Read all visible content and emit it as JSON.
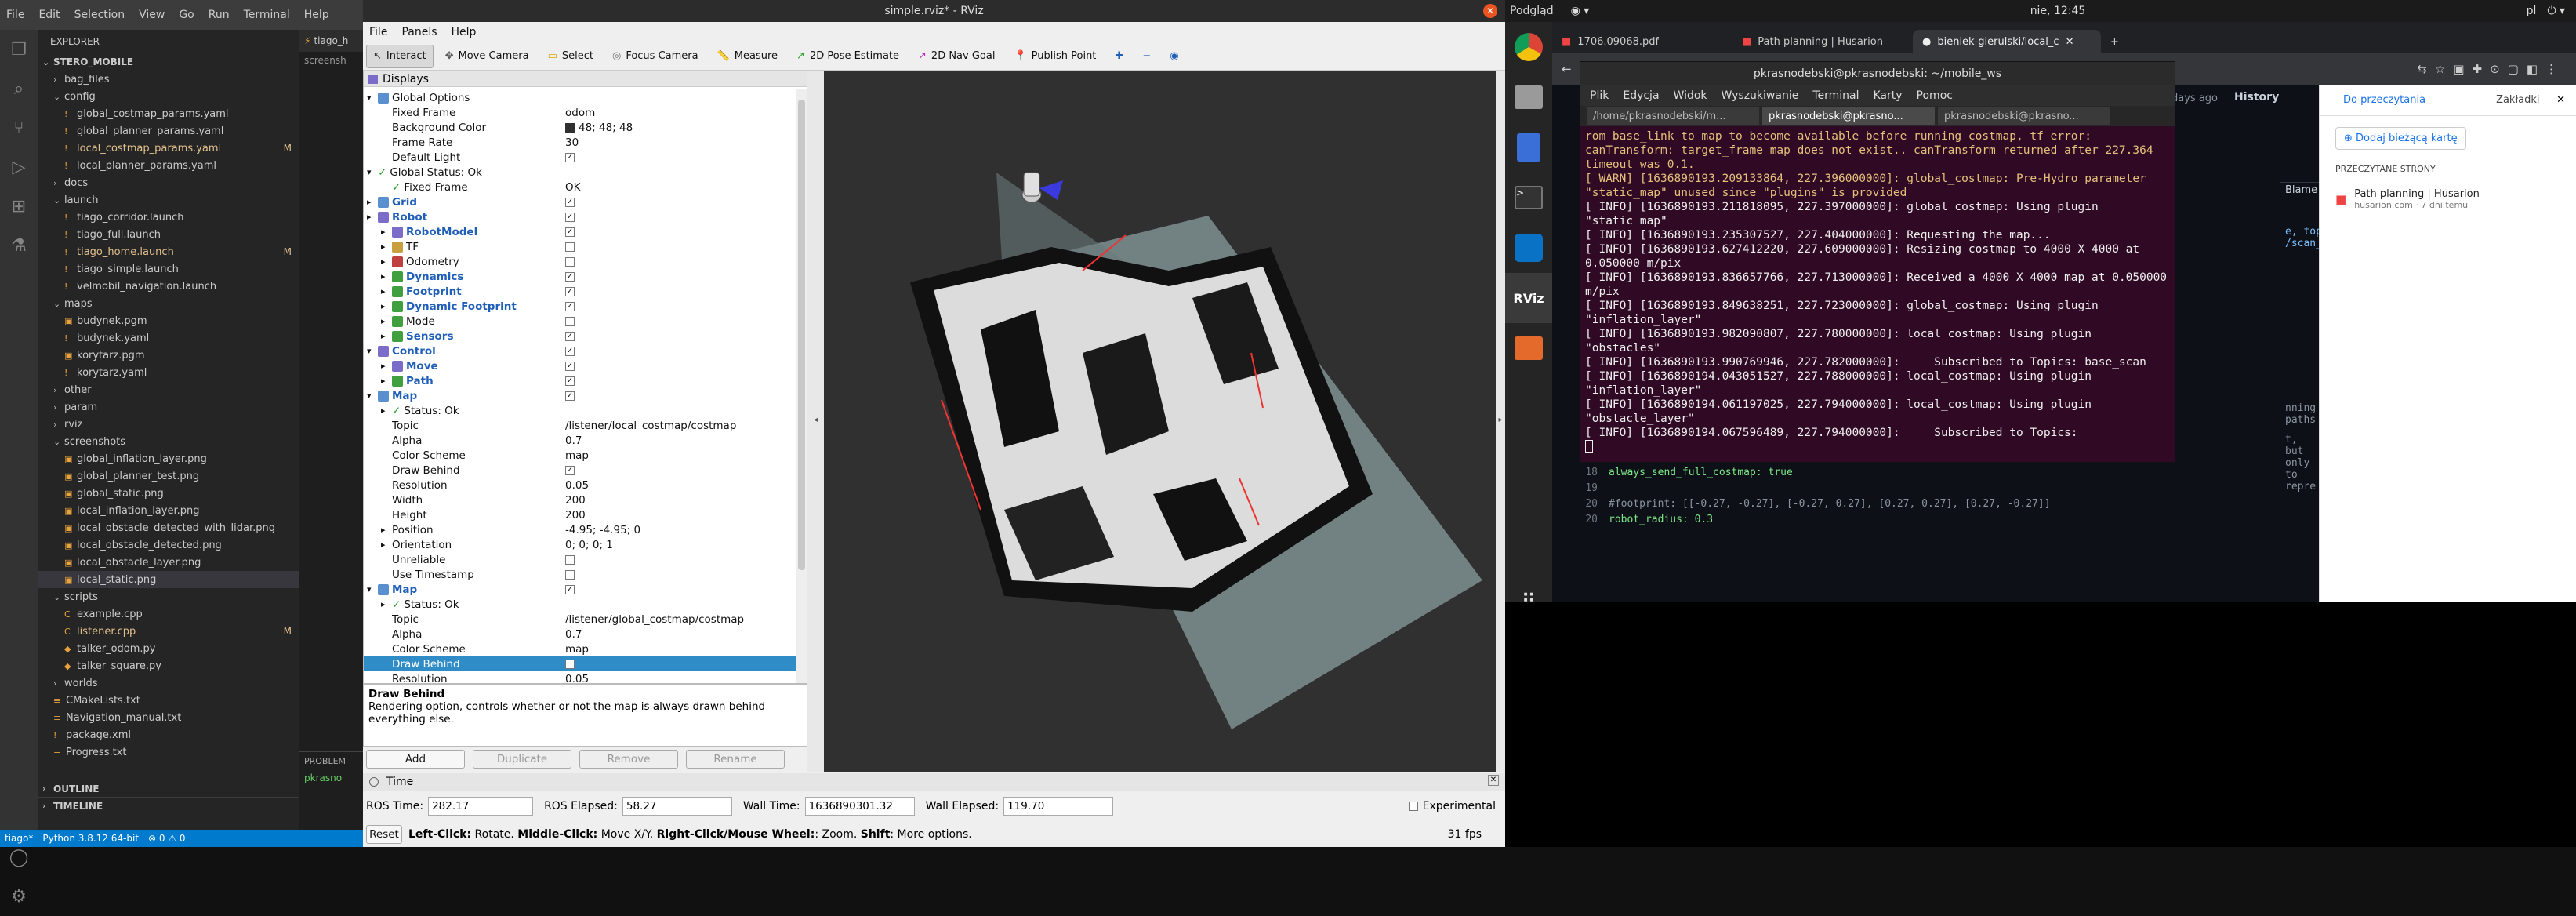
{
  "vscode": {
    "menu": [
      "File",
      "Edit",
      "Selection",
      "View",
      "Go",
      "Run",
      "Terminal",
      "Help"
    ],
    "explorer_title": "EXPLORER",
    "tree": [
      {
        "t": "STERO_MOBILE",
        "d": 0,
        "type": "root"
      },
      {
        "t": "bag_files",
        "d": 1,
        "type": "folder",
        "open": false
      },
      {
        "t": "config",
        "d": 1,
        "type": "folder",
        "open": true
      },
      {
        "t": "global_costmap_params.yaml",
        "d": 2,
        "type": "file"
      },
      {
        "t": "global_planner_params.yaml",
        "d": 2,
        "type": "file"
      },
      {
        "t": "local_costmap_params.yaml",
        "d": 2,
        "type": "file",
        "mod": "M"
      },
      {
        "t": "local_planner_params.yaml",
        "d": 2,
        "type": "file"
      },
      {
        "t": "docs",
        "d": 1,
        "type": "folder",
        "open": false
      },
      {
        "t": "launch",
        "d": 1,
        "type": "folder",
        "open": true
      },
      {
        "t": "tiago_corridor.launch",
        "d": 2,
        "type": "file"
      },
      {
        "t": "tiago_full.launch",
        "d": 2,
        "type": "file"
      },
      {
        "t": "tiago_home.launch",
        "d": 2,
        "type": "file",
        "mod": "M"
      },
      {
        "t": "tiago_simple.launch",
        "d": 2,
        "type": "file"
      },
      {
        "t": "velmobil_navigation.launch",
        "d": 2,
        "type": "file"
      },
      {
        "t": "maps",
        "d": 1,
        "type": "folder",
        "open": true
      },
      {
        "t": "budynek.pgm",
        "d": 2,
        "type": "file"
      },
      {
        "t": "budynek.yaml",
        "d": 2,
        "type": "file"
      },
      {
        "t": "korytarz.pgm",
        "d": 2,
        "type": "file"
      },
      {
        "t": "korytarz.yaml",
        "d": 2,
        "type": "file"
      },
      {
        "t": "other",
        "d": 1,
        "type": "folder",
        "open": false
      },
      {
        "t": "param",
        "d": 1,
        "type": "folder",
        "open": false
      },
      {
        "t": "rviz",
        "d": 1,
        "type": "folder",
        "open": false
      },
      {
        "t": "screenshots",
        "d": 1,
        "type": "folder",
        "open": true
      },
      {
        "t": "global_inflation_layer.png",
        "d": 2,
        "type": "file"
      },
      {
        "t": "global_planner_test.png",
        "d": 2,
        "type": "file"
      },
      {
        "t": "global_static.png",
        "d": 2,
        "type": "file"
      },
      {
        "t": "local_inflation_layer.png",
        "d": 2,
        "type": "file"
      },
      {
        "t": "local_obstacle_detected_with_lidar.png",
        "d": 2,
        "type": "file"
      },
      {
        "t": "local_obstacle_detected.png",
        "d": 2,
        "type": "file"
      },
      {
        "t": "local_obstacle_layer.png",
        "d": 2,
        "type": "file"
      },
      {
        "t": "local_static.png",
        "d": 2,
        "type": "file",
        "sel": true
      },
      {
        "t": "scripts",
        "d": 1,
        "type": "folder",
        "open": true
      },
      {
        "t": "example.cpp",
        "d": 2,
        "type": "file"
      },
      {
        "t": "listener.cpp",
        "d": 2,
        "type": "file",
        "mod": "M"
      },
      {
        "t": "talker_odom.py",
        "d": 2,
        "type": "file"
      },
      {
        "t": "talker_square.py",
        "d": 2,
        "type": "file"
      },
      {
        "t": "worlds",
        "d": 1,
        "type": "folder",
        "open": false
      },
      {
        "t": "CMakeLists.txt",
        "d": 1,
        "type": "file"
      },
      {
        "t": "Navigation_manual.txt",
        "d": 1,
        "type": "file"
      },
      {
        "t": "package.xml",
        "d": 1,
        "type": "file"
      },
      {
        "t": "Progress.txt",
        "d": 1,
        "type": "file"
      }
    ],
    "outline": "OUTLINE",
    "timeline": "TIMELINE",
    "editor_tab": "tiago_h",
    "editor_crumb": "screensh",
    "problems": "PROBLEM",
    "terminal_snip": "pkrasno",
    "status": {
      "branch": "tiago*",
      "python": "Python 3.8.12 64-bit",
      "errors": "⊗ 0 ⚠ 0"
    }
  },
  "topbar": {
    "left": "Podgląd",
    "clock": "nie, 12:45",
    "lang": "pl"
  },
  "rviz": {
    "title": "simple.rviz* - RViz",
    "menu": [
      "File",
      "Panels",
      "Help"
    ],
    "tools": [
      {
        "label": "Interact",
        "active": true
      },
      {
        "label": "Move Camera"
      },
      {
        "label": "Select"
      },
      {
        "label": "Focus Camera"
      },
      {
        "label": "Measure"
      },
      {
        "label": "2D Pose Estimate"
      },
      {
        "label": "2D Nav Goal"
      },
      {
        "label": "Publish Point"
      }
    ],
    "panel_title": "Displays",
    "rows": [
      {
        "d": 0,
        "e": "▾",
        "icon": "#5a8fd0",
        "k": "Global Options",
        "v": ""
      },
      {
        "d": 1,
        "k": "Fixed Frame",
        "v": "odom"
      },
      {
        "d": 1,
        "k": "Background Color",
        "v": "48; 48; 48",
        "swatch": "#303030"
      },
      {
        "d": 1,
        "k": "Frame Rate",
        "v": "30"
      },
      {
        "d": 1,
        "k": "Default Light",
        "v": "",
        "chk": "✓"
      },
      {
        "d": 0,
        "e": "▾",
        "ok": true,
        "k": "Global Status: Ok",
        "v": ""
      },
      {
        "d": 1,
        "ok": true,
        "k": "Fixed Frame",
        "v": "OK"
      },
      {
        "d": 0,
        "e": "▸",
        "icon": "#5a8fd0",
        "k": "Grid",
        "blue": true,
        "v": "",
        "chk": "✓"
      },
      {
        "d": 0,
        "e": "▸",
        "icon": "#7a6cc8",
        "k": "Robot",
        "blue": true,
        "v": "",
        "chk": "✓"
      },
      {
        "d": 1,
        "e": "▸",
        "icon": "#7a6cc8",
        "k": "RobotModel",
        "blue": true,
        "v": "",
        "chk": "✓"
      },
      {
        "d": 1,
        "e": "▸",
        "icon": "#c8a040",
        "k": "TF",
        "v": "",
        "chk": ""
      },
      {
        "d": 1,
        "e": "▸",
        "icon": "#c04040",
        "k": "Odometry",
        "v": "",
        "chk": ""
      },
      {
        "d": 1,
        "e": "▸",
        "icon": "#40a040",
        "k": "Dynamics",
        "blue": true,
        "v": "",
        "chk": "✓"
      },
      {
        "d": 1,
        "e": "▸",
        "icon": "#40a040",
        "k": "Footprint",
        "blue": true,
        "v": "",
        "chk": "✓"
      },
      {
        "d": 1,
        "e": "▸",
        "icon": "#40a040",
        "k": "Dynamic Footprint",
        "blue": true,
        "v": "",
        "chk": "✓"
      },
      {
        "d": 1,
        "e": "▸",
        "icon": "#40a040",
        "k": "Mode",
        "v": "",
        "chk": ""
      },
      {
        "d": 1,
        "e": "▸",
        "icon": "#40a040",
        "k": "Sensors",
        "blue": true,
        "v": "",
        "chk": "✓"
      },
      {
        "d": 0,
        "e": "▾",
        "icon": "#7a6cc8",
        "k": "Control",
        "blue": true,
        "v": "",
        "chk": "✓"
      },
      {
        "d": 1,
        "e": "▸",
        "icon": "#7a6cc8",
        "k": "Move",
        "blue": true,
        "v": "",
        "chk": "✓"
      },
      {
        "d": 1,
        "e": "▸",
        "icon": "#40a040",
        "k": "Path",
        "blue": true,
        "v": "",
        "chk": "✓"
      },
      {
        "d": 0,
        "e": "▾",
        "icon": "#5a8fd0",
        "k": "Map",
        "blue": true,
        "v": "",
        "chk": "✓"
      },
      {
        "d": 1,
        "e": "▸",
        "ok": true,
        "k": "Status: Ok",
        "v": ""
      },
      {
        "d": 1,
        "k": "Topic",
        "v": "/listener/local_costmap/costmap"
      },
      {
        "d": 1,
        "k": "Alpha",
        "v": "0.7"
      },
      {
        "d": 1,
        "k": "Color Scheme",
        "v": "map"
      },
      {
        "d": 1,
        "k": "Draw Behind",
        "v": "",
        "chk": "✓"
      },
      {
        "d": 1,
        "k": "Resolution",
        "v": "0.05"
      },
      {
        "d": 1,
        "k": "Width",
        "v": "200"
      },
      {
        "d": 1,
        "k": "Height",
        "v": "200"
      },
      {
        "d": 1,
        "e": "▸",
        "k": "Position",
        "v": "-4.95; -4.95; 0"
      },
      {
        "d": 1,
        "e": "▸",
        "k": "Orientation",
        "v": "0; 0; 0; 1"
      },
      {
        "d": 1,
        "k": "Unreliable",
        "v": "",
        "chk": ""
      },
      {
        "d": 1,
        "k": "Use Timestamp",
        "v": "",
        "chk": ""
      },
      {
        "d": 0,
        "e": "▾",
        "icon": "#5a8fd0",
        "k": "Map",
        "blue": true,
        "v": "",
        "chk": "✓"
      },
      {
        "d": 1,
        "e": "▸",
        "ok": true,
        "k": "Status: Ok",
        "v": ""
      },
      {
        "d": 1,
        "k": "Topic",
        "v": "/listener/global_costmap/costmap"
      },
      {
        "d": 1,
        "k": "Alpha",
        "v": "0.7"
      },
      {
        "d": 1,
        "k": "Color Scheme",
        "v": "map"
      },
      {
        "d": 1,
        "k": "Draw Behind",
        "v": "",
        "chk": "",
        "sel": true
      },
      {
        "d": 1,
        "k": "Resolution",
        "v": "0.05"
      }
    ],
    "desc_title": "Draw Behind",
    "desc_text": "Rendering option, controls whether or not the map is always drawn behind everything else.",
    "buttons": {
      "add": "Add",
      "duplicate": "Duplicate",
      "remove": "Remove",
      "rename": "Rename"
    },
    "time_title": "Time",
    "ros_time_label": "ROS Time:",
    "ros_time": "282.17",
    "ros_elapsed_label": "ROS Elapsed:",
    "ros_elapsed": "58.27",
    "wall_time_label": "Wall Time:",
    "wall_time": "1636890301.32",
    "wall_elapsed_label": "Wall Elapsed:",
    "wall_elapsed": "119.70",
    "experimental": "Experimental",
    "reset": "Reset",
    "hint_b1": "Left-Click:",
    "hint_t1": " Rotate. ",
    "hint_b2": "Middle-Click:",
    "hint_t2": " Move X/Y. ",
    "hint_b3": "Right-Click/Mouse Wheel:",
    "hint_t3": ": Zoom. ",
    "hint_b4": "Shift",
    "hint_t4": ": More options.",
    "fps": "31 fps"
  },
  "chrome": {
    "tabs": [
      "1706.09068.pdf",
      "Path planning | Husarion",
      "bieniek-gierulski/local_c"
    ],
    "github": {
      "ago": "days ago",
      "history": "History",
      "blame": "Blame",
      "code_lines": [
        {
          "n": "18",
          "t": "always_send_full_costmap: true"
        },
        {
          "n": "19",
          "t": ""
        },
        {
          "n": "20",
          "t": "#footprint: [[-0.27, -0.27], [-0.27, 0.27], [0.27, 0.27], [0.27, -0.27]]"
        },
        {
          "n": "20",
          "t": "robot_radius: 0.3"
        }
      ],
      "frag1": "e, topic: /scan_raw}",
      "frag2": "nning paths",
      "frag3": "t, but only to repre"
    },
    "reading_list": {
      "tab1": "Do przeczytania",
      "tab2": "Zakładki",
      "add": "Dodaj bieżącą kartę",
      "unread": "PRZECZYTANE STRONY",
      "item_title": "Path planning | Husarion",
      "item_sub": "husarion.com · 7 dni temu"
    }
  },
  "terminal": {
    "title": "pkrasnodebski@pkrasnodebski: ~/mobile_ws",
    "menu": [
      "Plik",
      "Edycja",
      "Widok",
      "Wyszukiwanie",
      "Terminal",
      "Karty",
      "Pomoc"
    ],
    "tabs": [
      "/home/pkrasnodebski/m...",
      "pkrasnodebski@pkrasno...",
      "pkrasnodebski@pkrasno..."
    ],
    "lines": [
      {
        "w": true,
        "t": "rom base_link to map to become available before running costmap, tf error: canTransform: target_frame map does not exist.. canTransform returned after 227.364 timeout was 0.1."
      },
      {
        "w": true,
        "t": "[ WARN] [1636890193.209133864, 227.396000000]: global_costmap: Pre-Hydro parameter \"static_map\" unused since \"plugins\" is provided"
      },
      {
        "t": "[ INFO] [1636890193.211818095, 227.397000000]: global_costmap: Using plugin \"static_map\""
      },
      {
        "t": "[ INFO] [1636890193.235307527, 227.404000000]: Requesting the map..."
      },
      {
        "t": "[ INFO] [1636890193.627412220, 227.609000000]: Resizing costmap to 4000 X 4000 at 0.050000 m/pix"
      },
      {
        "t": "[ INFO] [1636890193.836657766, 227.713000000]: Received a 4000 X 4000 map at 0.050000 m/pix"
      },
      {
        "t": "[ INFO] [1636890193.849638251, 227.723000000]: global_costmap: Using plugin \"inflation_layer\""
      },
      {
        "t": "[ INFO] [1636890193.982090807, 227.780000000]: local_costmap: Using plugin \"obstacles\""
      },
      {
        "t": "[ INFO] [1636890193.990769946, 227.782000000]:     Subscribed to Topics: base_scan"
      },
      {
        "t": "[ INFO] [1636890194.043051527, 227.788000000]: local_costmap: Using plugin \"inflation_layer\""
      },
      {
        "t": "[ INFO] [1636890194.061197025, 227.794000000]: local_costmap: Using plugin \"obstacle_layer\""
      },
      {
        "t": "[ INFO] [1636890194.067596489, 227.794000000]:     Subscribed to Topics:"
      }
    ]
  }
}
